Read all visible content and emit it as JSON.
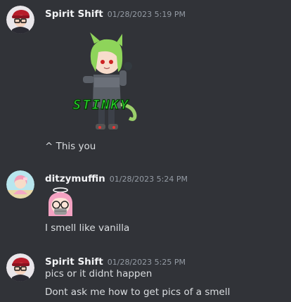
{
  "messages": [
    {
      "username": "Spirit Shift",
      "timestamp": "01/28/2023 5:19 PM",
      "attachment": {
        "kind": "sticker",
        "text": "STINKY"
      },
      "lines": [
        "^ This you"
      ]
    },
    {
      "username": "ditzymuffin",
      "timestamp": "01/28/2023 5:24 PM",
      "attachment": {
        "kind": "emoji"
      },
      "lines": [
        "I smell like vanilla"
      ]
    },
    {
      "username": "Spirit Shift",
      "timestamp": "01/28/2023 5:25 PM",
      "lines": [
        "pics or it didnt happen",
        "Dont ask me how to get pics of a smell"
      ]
    }
  ],
  "colors": {
    "background": "#313338",
    "username": "#f2f3f5",
    "timestamp": "#949ba4",
    "text": "#dbdee1",
    "sticker_green": "#27e22a"
  }
}
